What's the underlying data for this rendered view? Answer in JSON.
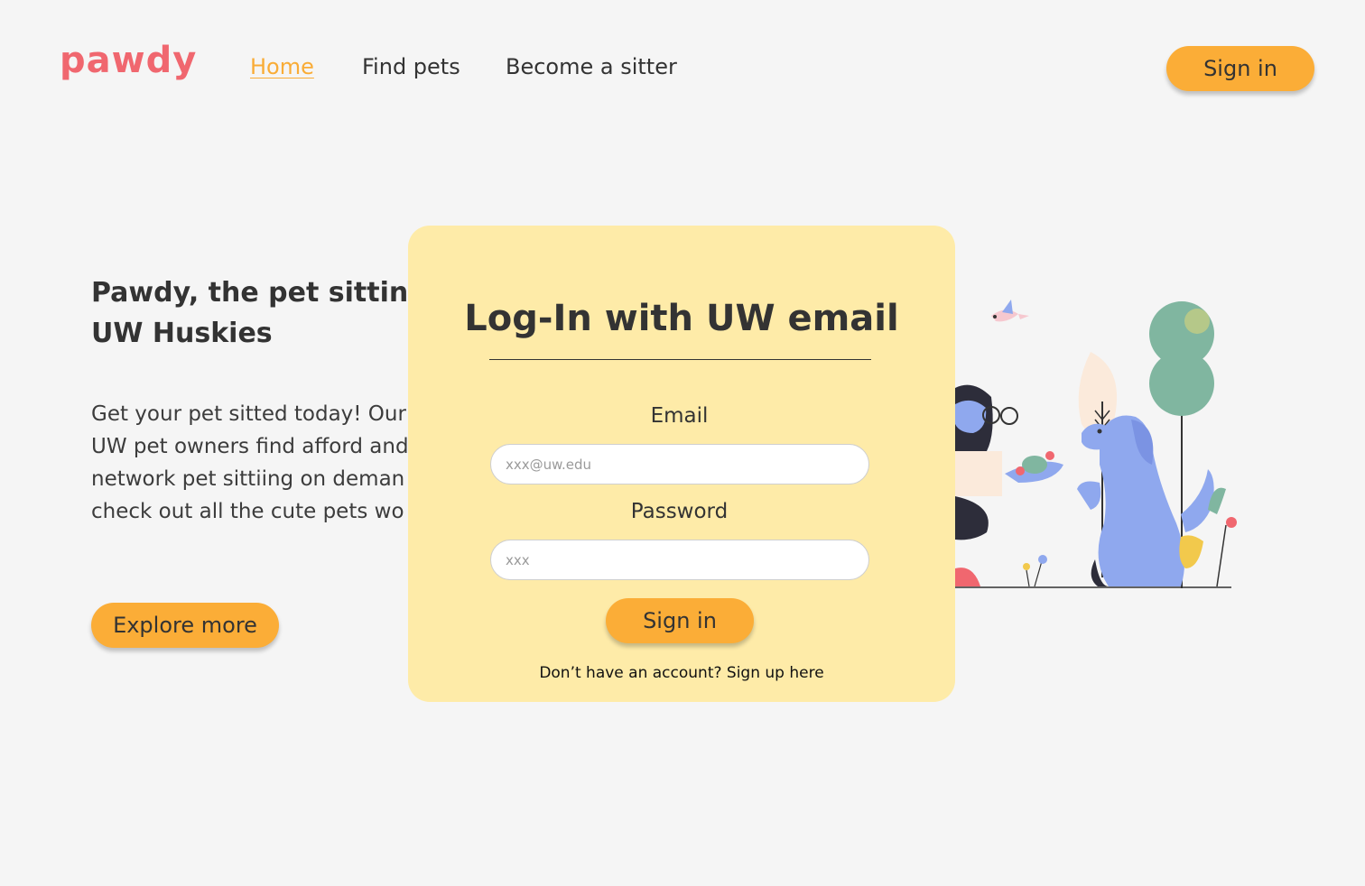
{
  "brand": {
    "logo": "pawdy",
    "logo_color": "#f0676f"
  },
  "nav": {
    "items": [
      {
        "label": "Home",
        "active": true
      },
      {
        "label": "Find pets",
        "active": false
      },
      {
        "label": "Become a sitter",
        "active": false
      }
    ],
    "signin_label": "Sign in"
  },
  "hero": {
    "title_line1": "Pawdy, the pet sitting c",
    "title_line2": "UW Huskies",
    "body_lines": [
      "Get your pet sitted today! Our",
      "UW pet owners find afford and",
      "network pet sittiing on deman",
      "check out all the cute pets wo"
    ],
    "cta_label": "Explore more"
  },
  "login_modal": {
    "title": "Log-In with UW email",
    "email_label": "Email",
    "email_placeholder": "xxx@uw.edu",
    "password_label": "Password",
    "password_placeholder": "xxx",
    "submit_label": "Sign in",
    "signup_prompt": "Don’t have an account? Sign up here"
  },
  "colors": {
    "accent": "#fbad37",
    "modal_bg": "#feeba8",
    "background": "#f5f5f5",
    "nav_active": "#f9ac36"
  },
  "icons": [
    "dog-illustration",
    "bird-icon",
    "tree-icon",
    "person-illustration"
  ]
}
